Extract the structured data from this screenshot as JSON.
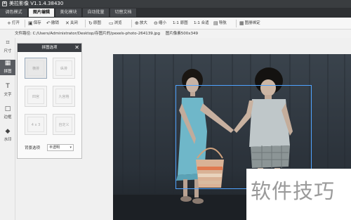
{
  "app": {
    "title": "美拉影像 V1.1.4.38430",
    "logo_text": "美"
  },
  "tabs": [
    {
      "label": "调色模式"
    },
    {
      "label": "图片编辑"
    },
    {
      "label": "美化模块"
    },
    {
      "label": "自动批量"
    },
    {
      "label": "切替文档"
    }
  ],
  "active_tab": "图片编辑",
  "toolbar": {
    "items": [
      {
        "label": "打开",
        "icon": "+"
      },
      {
        "label": "保存",
        "icon": "▣"
      },
      {
        "label": "撤销",
        "icon": "↶"
      },
      {
        "label": "关闭",
        "icon": "✕"
      },
      {
        "label": "原图",
        "icon": "↻"
      },
      {
        "label": "浏览",
        "icon": "▭"
      },
      {
        "label": "放大",
        "icon": "⊕"
      },
      {
        "label": "缩小",
        "icon": "⊖"
      },
      {
        "label": "1:1 原图",
        "icon": ""
      },
      {
        "label": "1:1 合适",
        "icon": ""
      },
      {
        "label": "导航",
        "icon": "▤"
      },
      {
        "label": "图册绑定",
        "icon": "▦"
      }
    ]
  },
  "path": {
    "label": "文件路径:",
    "value": "C:/Users/Administrator/Desktop/存图片的/pexels-photo-264139.jpg",
    "size_label": "图片像素500x349"
  },
  "sidebar": {
    "items": [
      {
        "label": "尺寸",
        "icon": "⌗"
      },
      {
        "label": "拼图",
        "icon": "▦"
      },
      {
        "label": "文字",
        "icon": "T"
      },
      {
        "label": "边框",
        "icon": "□"
      },
      {
        "label": "水印",
        "icon": "◆"
      }
    ],
    "active": "拼图"
  },
  "panel": {
    "title": "拼图选项",
    "close": "✕",
    "templates": [
      "横排",
      "纵排",
      "四宫",
      "九宫格",
      "4 x 3",
      "自定义"
    ],
    "selected_template": "横排",
    "bg_label": "背景选项",
    "bg_value": "半透明"
  },
  "overlay": {
    "watermark_text": "软件技巧"
  }
}
